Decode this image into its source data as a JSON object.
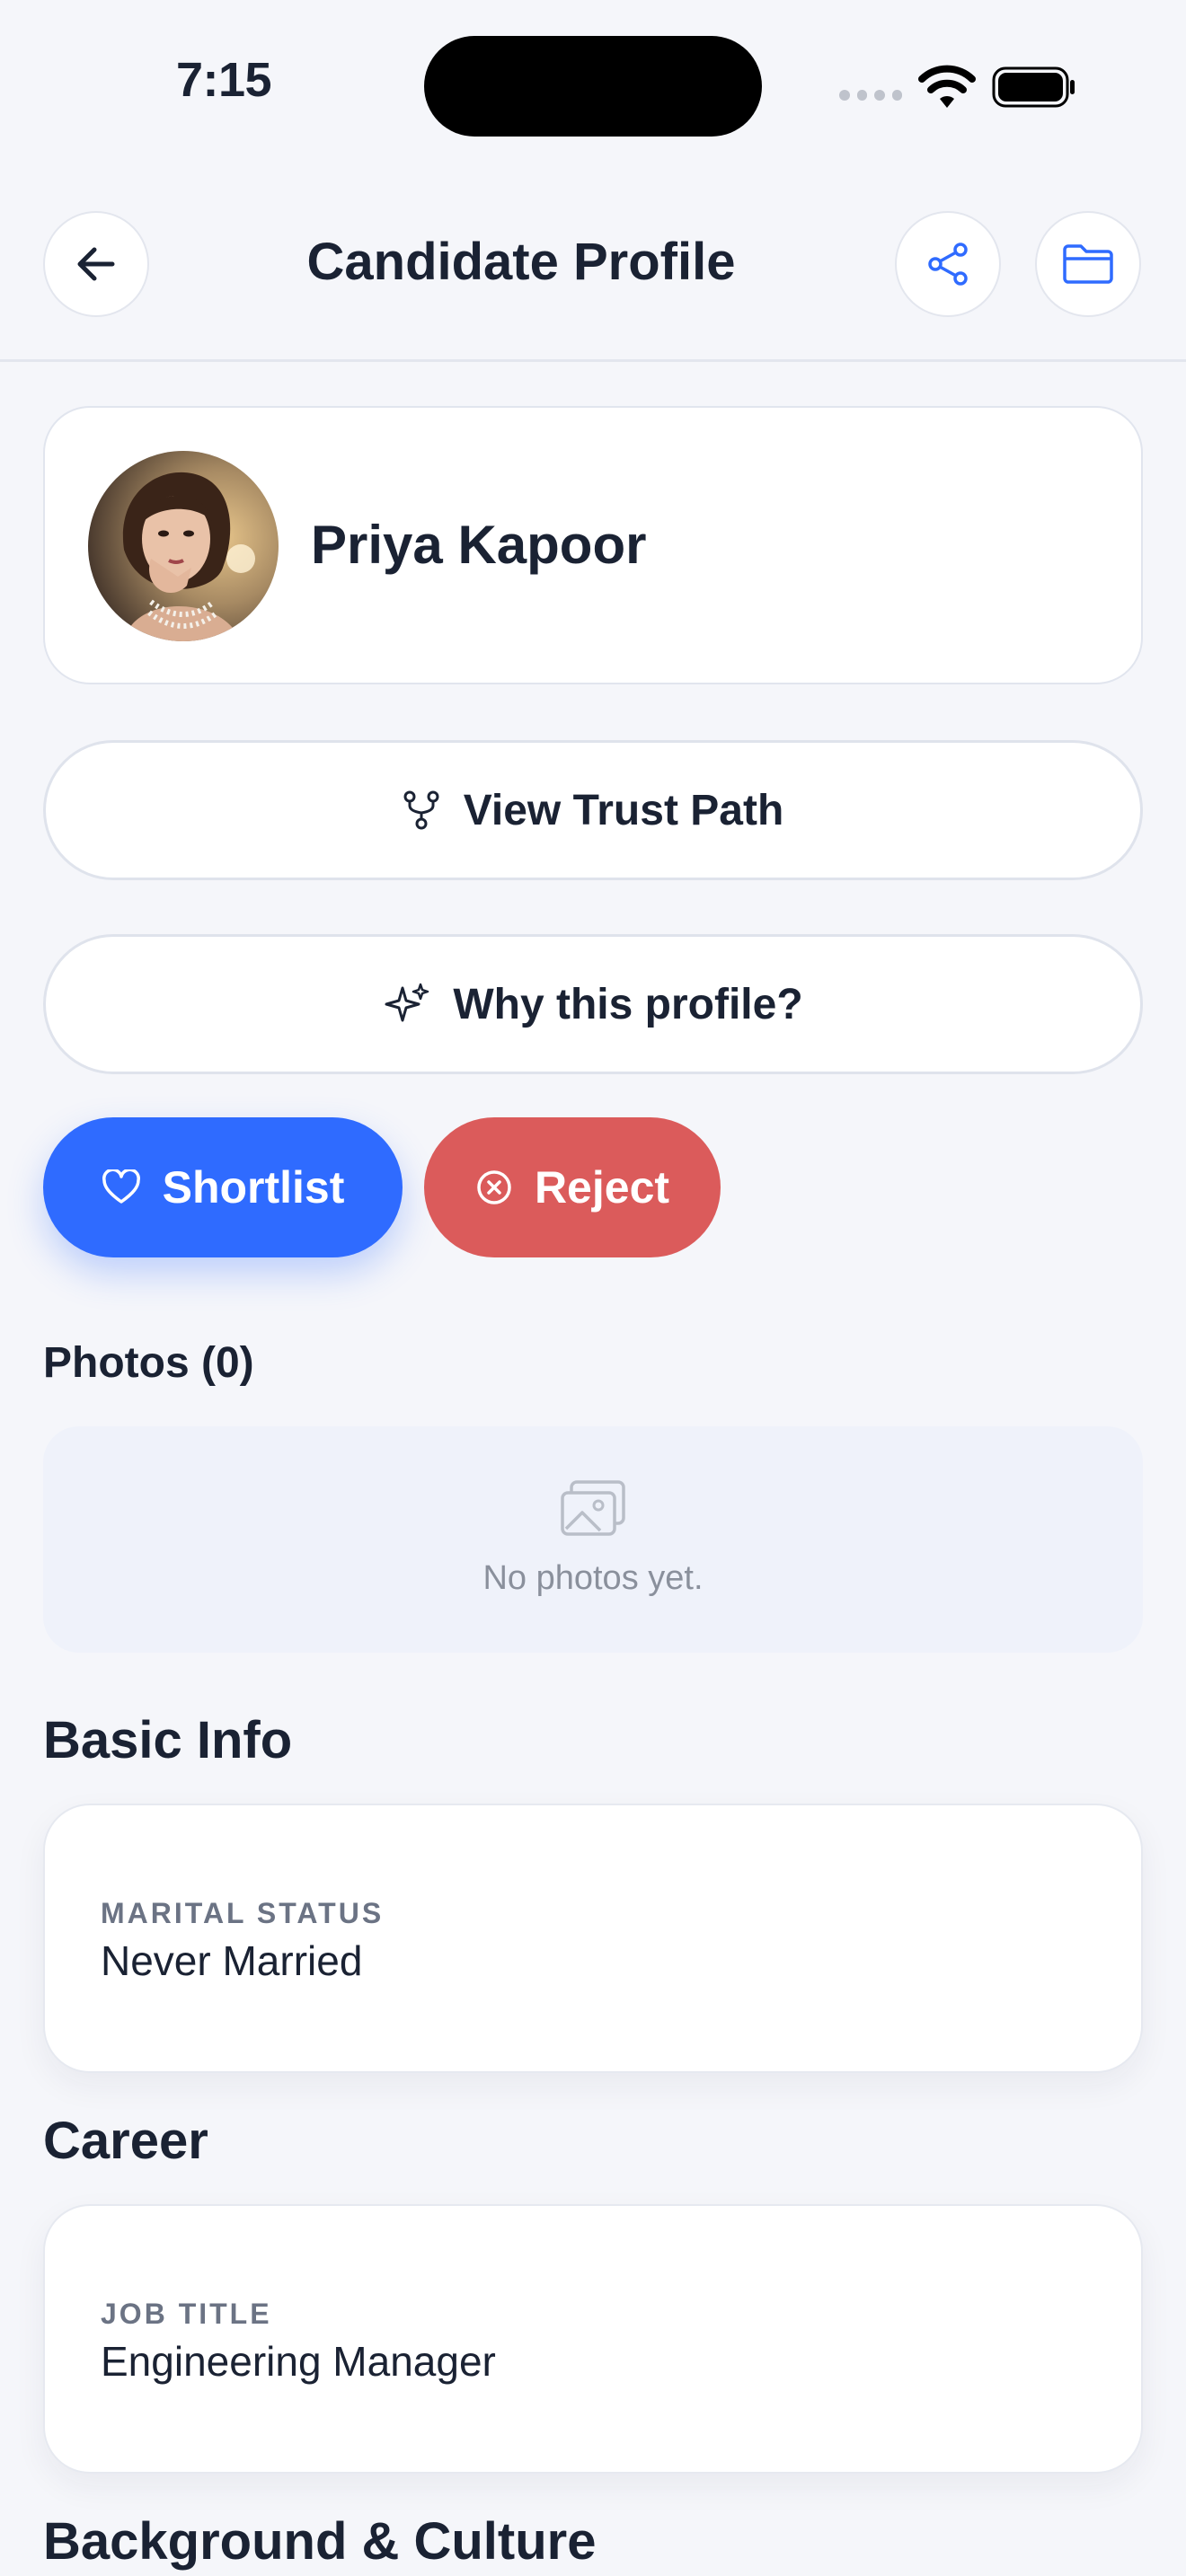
{
  "status_bar": {
    "time": "7:15"
  },
  "header": {
    "title": "Candidate Profile"
  },
  "profile": {
    "name": "Priya Kapoor"
  },
  "buttons": {
    "trust_path": "View Trust Path",
    "why_profile": "Why this profile?",
    "shortlist": "Shortlist",
    "reject": "Reject"
  },
  "photos": {
    "label": "Photos (0)",
    "empty_text": "No photos yet."
  },
  "sections": {
    "basic_info": {
      "title": "Basic Info",
      "field_label": "MARITAL STATUS",
      "field_value": "Never Married"
    },
    "career": {
      "title": "Career",
      "field_label": "JOB TITLE",
      "field_value": "Engineering Manager"
    },
    "background": {
      "title": "Background & Culture"
    }
  },
  "colors": {
    "accent": "#2f6bff",
    "reject": "#db5b5b",
    "text": "#1a2233",
    "muted": "#6b7384"
  },
  "icons": {
    "back": "arrow-left-icon",
    "share": "share-icon",
    "folder": "folder-icon",
    "trust": "fork-icon",
    "why": "sparkles-icon",
    "shortlist": "heart-icon",
    "reject": "x-circle-icon",
    "photo_placeholder": "image-icon"
  }
}
